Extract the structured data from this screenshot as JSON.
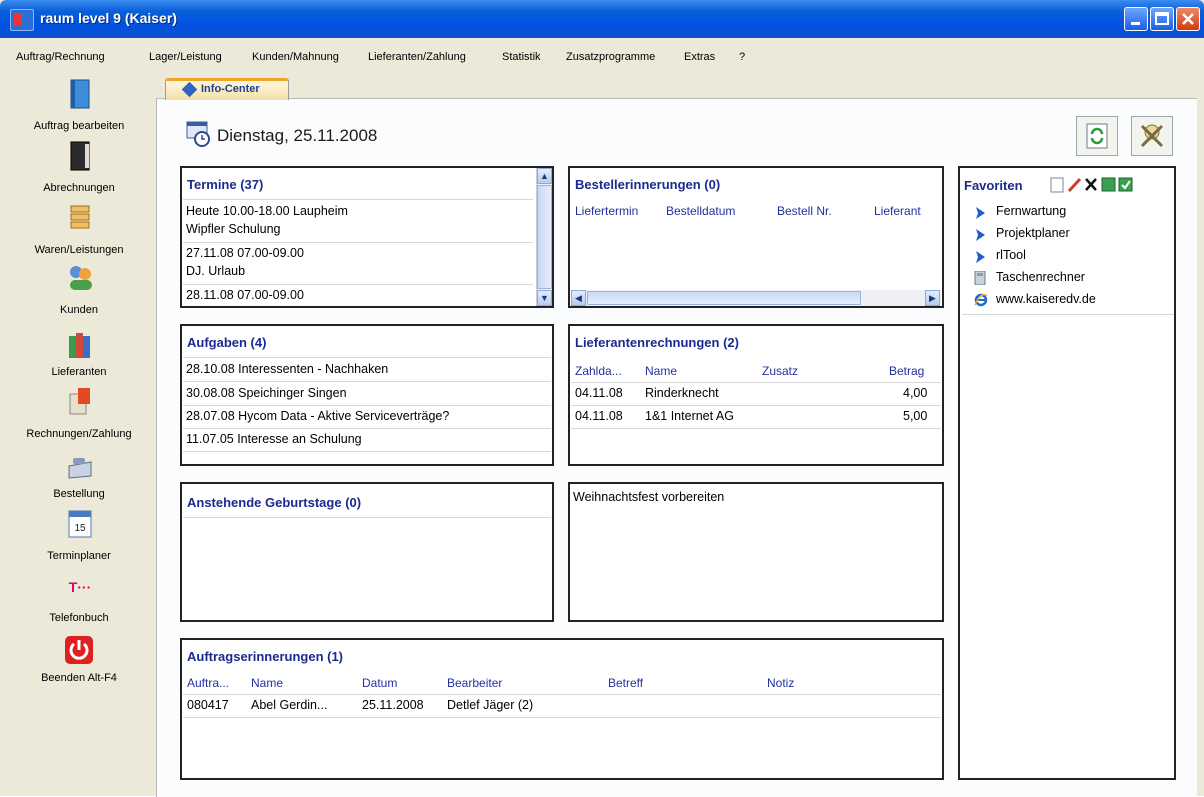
{
  "window": {
    "title": "raum level 9 (Kaiser)"
  },
  "menu": [
    "Auftrag/Rechnung",
    "Lager/Leistung",
    "Kunden/Mahnung",
    "Lieferanten/Zahlung",
    "Statistik",
    "Zusatzprogramme",
    "Extras",
    "?"
  ],
  "sidebar": [
    {
      "label": "Auftrag bearbeiten",
      "icon": "book-blue-icon"
    },
    {
      "label": "Abrechnungen",
      "icon": "book-black-icon"
    },
    {
      "label": "Waren/Leistungen",
      "icon": "stack-icon"
    },
    {
      "label": "Kunden",
      "icon": "people-icon"
    },
    {
      "label": "Lieferanten",
      "icon": "books-icon"
    },
    {
      "label": "Rechnungen/Zahlung",
      "icon": "invoice-icon"
    },
    {
      "label": "Bestellung",
      "icon": "phone-icon"
    },
    {
      "label": "Terminplaner",
      "icon": "calendar-icon",
      "badge": "15"
    },
    {
      "label": "Telefonbuch",
      "icon": "telekom-icon",
      "badge": "T···"
    },
    {
      "label": "Beenden Alt-F4",
      "icon": "power-icon"
    }
  ],
  "tab": {
    "label": "Info-Center"
  },
  "date": "Dienstag, 25.11.2008",
  "termine": {
    "title": "Termine (37)",
    "rows": [
      "Heute 10.00-18.00 Laupheim",
      "Wipfler Schulung",
      "27.11.08 07.00-09.00",
      "DJ. Urlaub",
      "28.11.08 07.00-09.00"
    ]
  },
  "bestell": {
    "title": "Bestellerinnerungen (0)",
    "headers": [
      "Liefertermin",
      "Bestelldatum",
      "Bestell Nr.",
      "Lieferant"
    ]
  },
  "aufgaben": {
    "title": "Aufgaben (4)",
    "rows": [
      "28.10.08 Interessenten - Nachhaken",
      "30.08.08 Speichinger Singen",
      "28.07.08 Hycom Data - Aktive Serviceverträge?",
      "11.07.05 Interesse an Schulung"
    ]
  },
  "lieferanten": {
    "title": "Lieferantenrechnungen (2)",
    "headers": [
      "Zahlda...",
      "Name",
      "Zusatz",
      "Betrag"
    ],
    "rows": [
      {
        "date": "04.11.08",
        "name": "Rinderknecht",
        "amount": "4,00"
      },
      {
        "date": "04.11.08",
        "name": "1&1 Internet AG",
        "amount": "5,00"
      }
    ]
  },
  "geburtstage": {
    "title": "Anstehende Geburtstage (0)"
  },
  "notiz": {
    "text": "Weihnachtsfest vorbereiten"
  },
  "auftrag": {
    "title": "Auftragserinnerungen (1)",
    "headers": [
      "Auftra...",
      "Name",
      "Datum",
      "Bearbeiter",
      "Betreff",
      "Notiz"
    ],
    "row": {
      "nr": "080417",
      "name": "Abel Gerdin...",
      "date": "25.11.2008",
      "worker": "Detlef Jäger (2)"
    }
  },
  "favoriten": {
    "title": "Favoriten",
    "items": [
      {
        "label": "Fernwartung",
        "icon": "triangle-arrow-icon"
      },
      {
        "label": "Projektplaner",
        "icon": "triangle-arrow-icon"
      },
      {
        "label": "rlTool",
        "icon": "triangle-arrow-icon"
      },
      {
        "label": "Taschenrechner",
        "icon": "calculator-icon"
      },
      {
        "label": "www.kaiseredv.de",
        "icon": "internet-explorer-icon"
      }
    ]
  },
  "colors": {
    "title_blue": "#0054e3",
    "panel_title": "#1b2a8e",
    "header_blue": "#2330a0"
  }
}
